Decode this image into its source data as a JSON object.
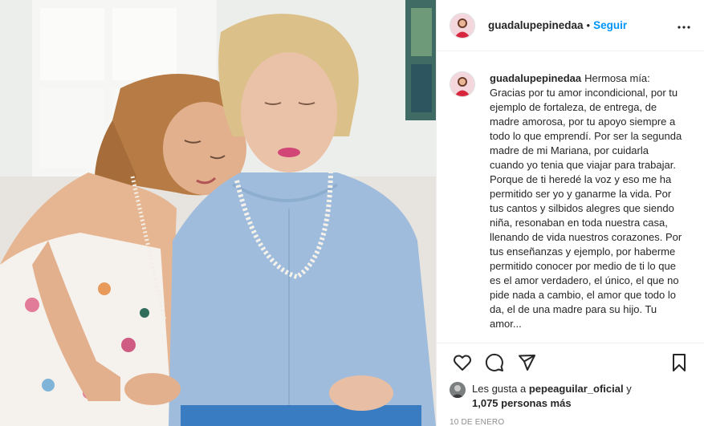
{
  "post": {
    "username": "guadalupepinedaa",
    "follow_label": "Seguir",
    "separator": "•",
    "more_label": "•••"
  },
  "caption": {
    "username": "guadalupepinedaa",
    "text": "Hermosa mía: Gracias por tu amor incondicional, por tu ejemplo de fortaleza, de entrega, de madre amorosa, por tu apoyo siempre a todo lo que emprendí. Por ser la segunda madre de mi Mariana, por cuidarla cuando yo tenia que viajar para trabajar. Porque de ti heredé la voz y eso me ha permitido ser yo y ganarme la vida. Por tus cantos y silbidos alegres que siendo niña, resonaban en toda nuestra casa, llenando de vida nuestros corazones. Por tus enseñanzas y ejemplo, por haberme permitido conocer por medio de ti lo que es el amor verdadero, el único, el que no pide nada a cambio, el amor que todo lo da, el de una madre para su hijo. Tu amor..."
  },
  "actions": {
    "icons": [
      "heart-icon",
      "comment-icon",
      "share-icon",
      "bookmark-icon"
    ]
  },
  "likes": {
    "prefix": "Les gusta a",
    "liker": "pepeaguilar_oficial",
    "conjunction": "y",
    "count_text": "1,075 personas más"
  },
  "date": "10 DE ENERO",
  "colors": {
    "accent": "#0095f6",
    "text": "#262626",
    "muted": "#8e8e8e",
    "border": "#efefef"
  }
}
